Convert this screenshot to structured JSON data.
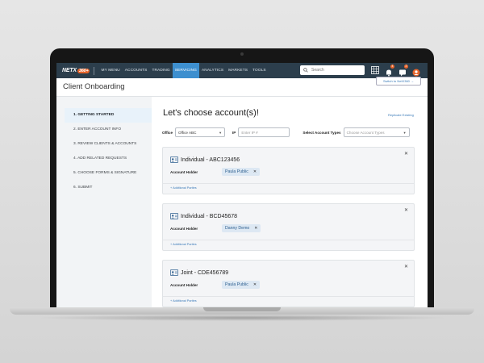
{
  "nav": {
    "logo": "NETX",
    "logo_badge": "360+",
    "items": [
      "MY MENU",
      "ACCOUNTS",
      "TRADING",
      "SERVICING",
      "ANALYTICS",
      "MARKETS",
      "TOOLS"
    ],
    "active_index": 3,
    "search_placeholder": "Search",
    "notif_count_1": "4",
    "notif_count_2": "2",
    "accent": "#3d8fcf",
    "bg": "#2c3e4c"
  },
  "header": {
    "title": "Client Onboarding",
    "switch_label": "Switch to NetX360 →"
  },
  "steps": [
    "1. GETTING STARTED",
    "2. ENTER ACCOUNT INFO",
    "3. REVIEW CLIENTS & ACCOUNTS",
    "4. ADD RELATED REQUESTS",
    "5. CHOOSE FORMS & SIGNATURE",
    "6. SUBMIT"
  ],
  "main": {
    "heading": "Let's choose account(s)!",
    "replicate_link": "Replicate Existing",
    "filters": {
      "office_label": "Office",
      "office_value": "Office ABC",
      "ip_label": "IP",
      "ip_placeholder": "Enter IP #",
      "types_label": "Select Account Types",
      "types_placeholder": "Choose Account Types"
    },
    "cards": [
      {
        "title": "Individual - ABC123456",
        "holder_label": "Account Holder",
        "holder": "Paula Public",
        "add_parties": "+ Additional Parties"
      },
      {
        "title": "Individual - BCD45678",
        "holder_label": "Account Holder",
        "holder": "Danny Demo",
        "add_parties": "+ Additional Parties"
      },
      {
        "title": "Joint - CDE456789",
        "holder_label": "Account Holder",
        "holder": "Paula Public",
        "add_parties": "+ Additional Parties"
      }
    ]
  }
}
